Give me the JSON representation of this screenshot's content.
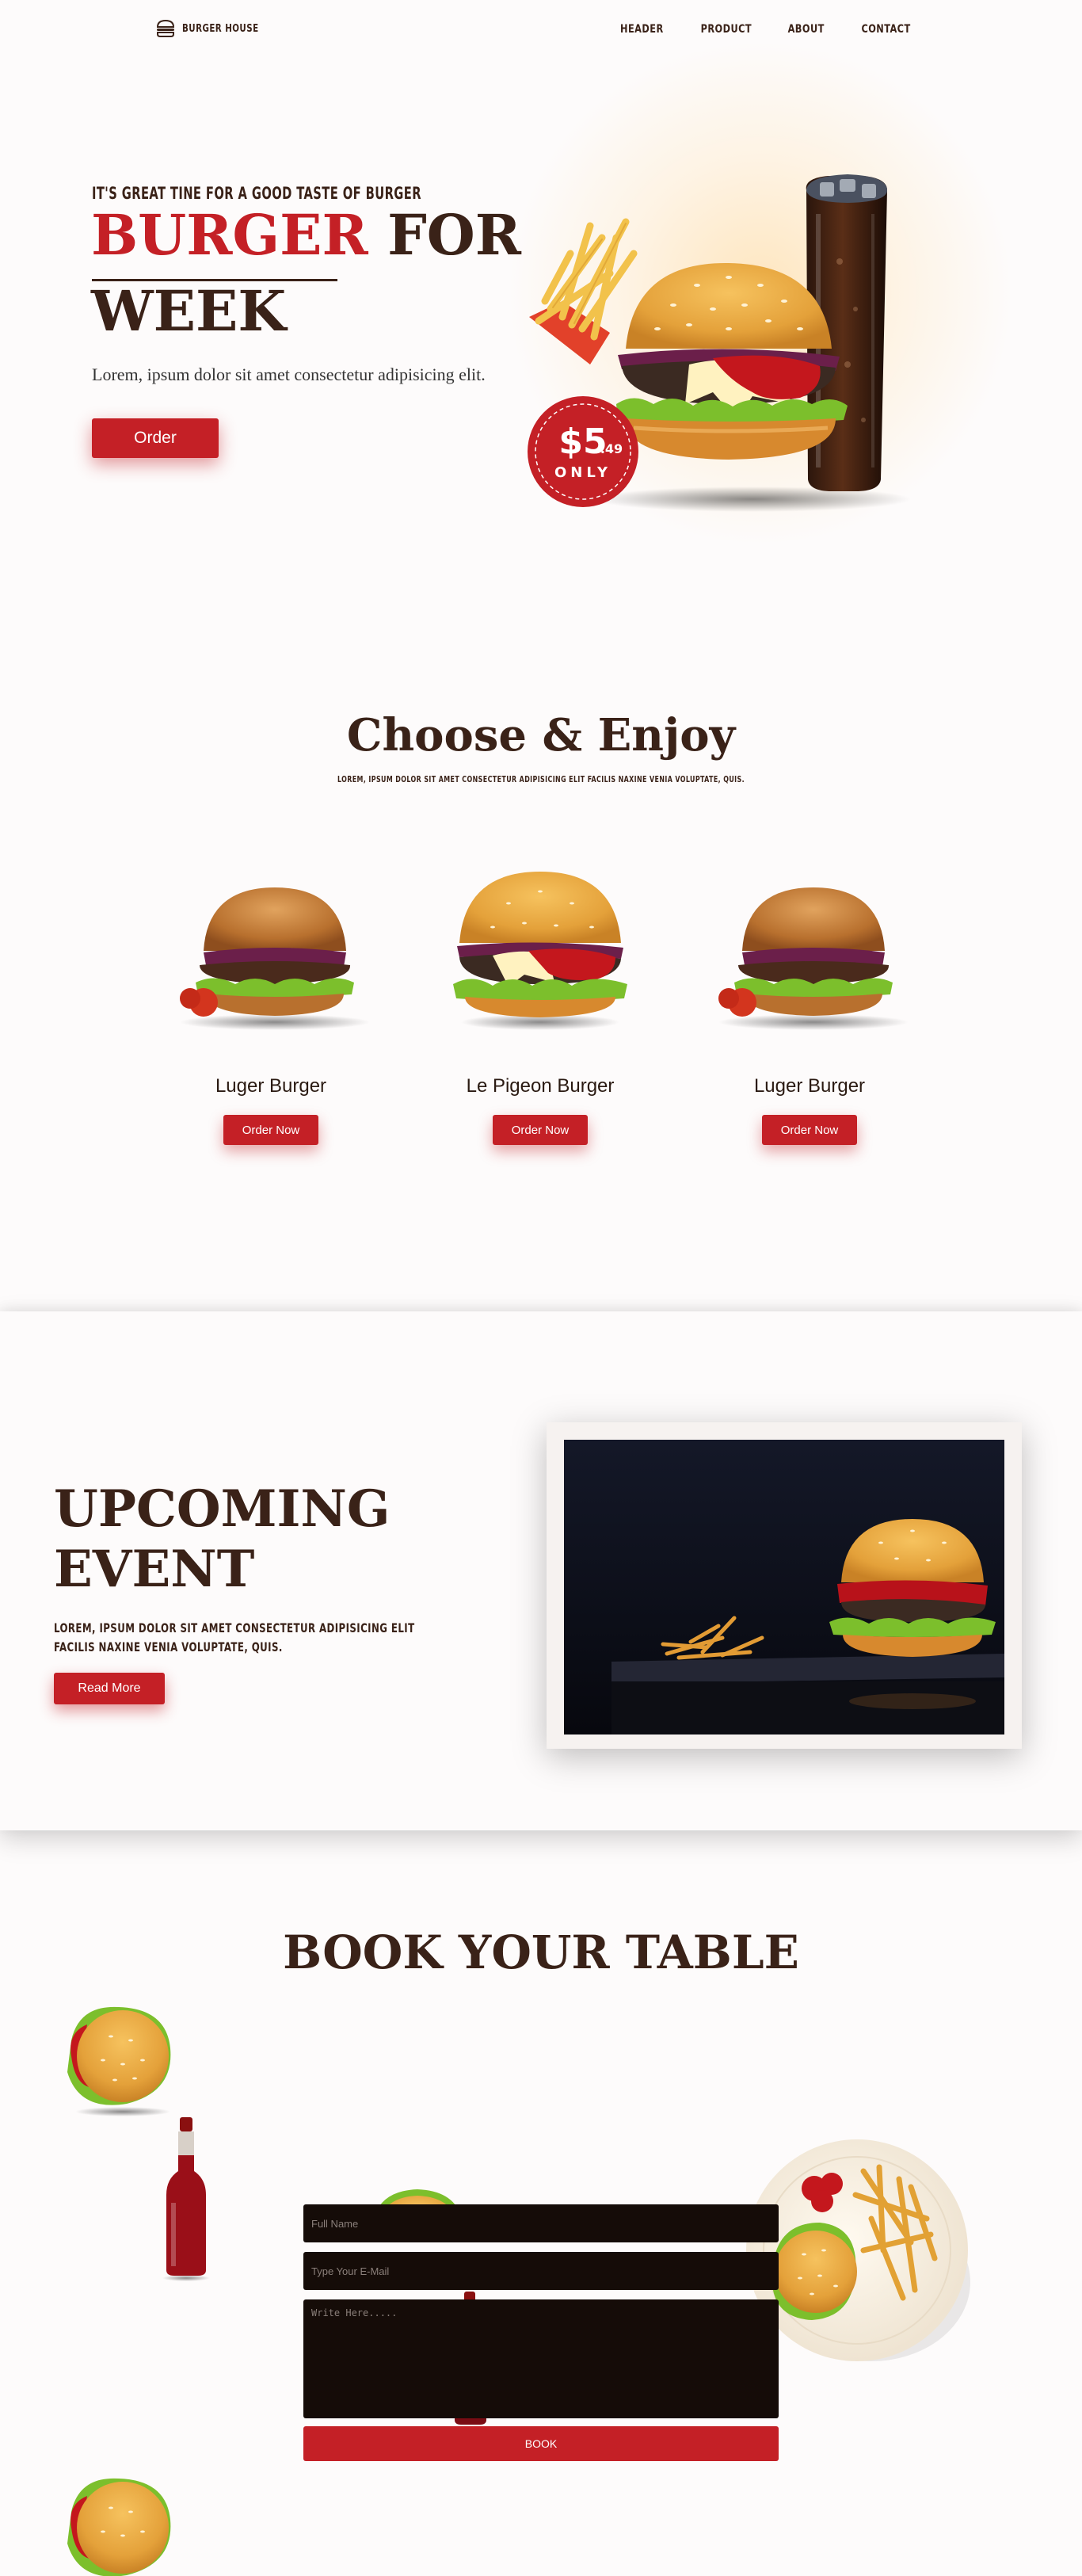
{
  "nav": {
    "logo_text": "BURGER HOUSE",
    "links": [
      "HEADER",
      "PRODUCT",
      "ABOUT",
      "CONTACT"
    ]
  },
  "hero": {
    "subtitle": "IT'S GREAT TINE FOR A GOOD TASTE OF BURGER",
    "title_red": "BURGER",
    "title_rest": "FOR",
    "title_line2": "WEEK",
    "description": "Lorem, ipsum dolor sit amet consectetur adipisicing elit.",
    "order_label": "Order",
    "price_main": "$5",
    "price_cents": ".49",
    "price_note": "ONLY"
  },
  "choose": {
    "title": "Choose & Enjoy",
    "subtitle": "LOREM, IPSUM DOLOR SIT AMET CONSECTETUR ADIPISICING ELIT FACILIS NAXINE VENIA VOLUPTATE, QUIS.",
    "products": [
      {
        "name": "Luger Burger",
        "button": "Order Now"
      },
      {
        "name": "Le Pigeon Burger",
        "button": "Order Now"
      },
      {
        "name": "Luger Burger",
        "button": "Order Now"
      }
    ]
  },
  "event": {
    "title_line1": "UPCOMING",
    "title_line2": "EVENT",
    "description": "LOREM, IPSUM DOLOR SIT AMET CONSECTETUR ADIPISICING ELIT FACILIS NAXINE VENIA VOLUPTATE, QUIS.",
    "button": "Read More"
  },
  "book": {
    "title": "BOOK YOUR TABLE",
    "name_placeholder": "Full Name",
    "email_placeholder": "Type Your E-Mail",
    "message_placeholder": "Write Here.....",
    "button": "BOOK"
  },
  "colors": {
    "accent": "#c42026",
    "dark": "#3a2218",
    "field_bg": "#150c08"
  }
}
